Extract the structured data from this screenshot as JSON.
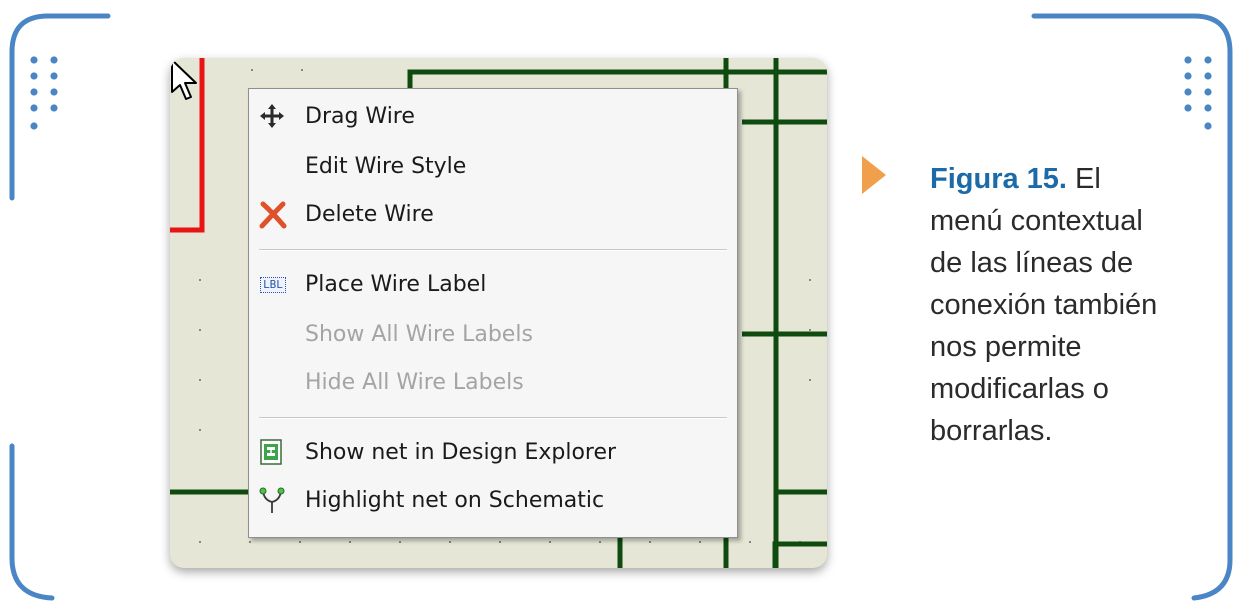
{
  "figure": {
    "label": "Figura 15.",
    "caption": " El menú contextual de las líneas de conexión también nos permite modificarlas o borrarlas."
  },
  "context_menu": {
    "groups": [
      {
        "items": [
          {
            "label": "Drag Wire",
            "icon": "drag-move-icon",
            "enabled": true
          },
          {
            "label": "Edit Wire Style",
            "icon": "",
            "enabled": true
          },
          {
            "label": "Delete Wire",
            "icon": "delete-x-icon",
            "enabled": true
          }
        ]
      },
      {
        "items": [
          {
            "label": "Place Wire Label",
            "icon": "wire-label-icon",
            "enabled": true
          },
          {
            "label": "Show All Wire Labels",
            "icon": "",
            "enabled": false
          },
          {
            "label": "Hide All Wire Labels",
            "icon": "",
            "enabled": false
          }
        ]
      },
      {
        "items": [
          {
            "label": "Show net in Design Explorer",
            "icon": "design-explorer-icon",
            "enabled": true
          },
          {
            "label": "Highlight net on Schematic",
            "icon": "highlight-net-icon",
            "enabled": true
          }
        ]
      }
    ],
    "icon_text": "LBL"
  },
  "colors": {
    "accent_blue": "#1c6aa8",
    "frame_blue": "#4a86c5",
    "marker_orange": "#f0a04b",
    "wire_green": "#0f4a0f",
    "wire_red": "#e81414",
    "canvas_bg": "#e6e6d6"
  }
}
